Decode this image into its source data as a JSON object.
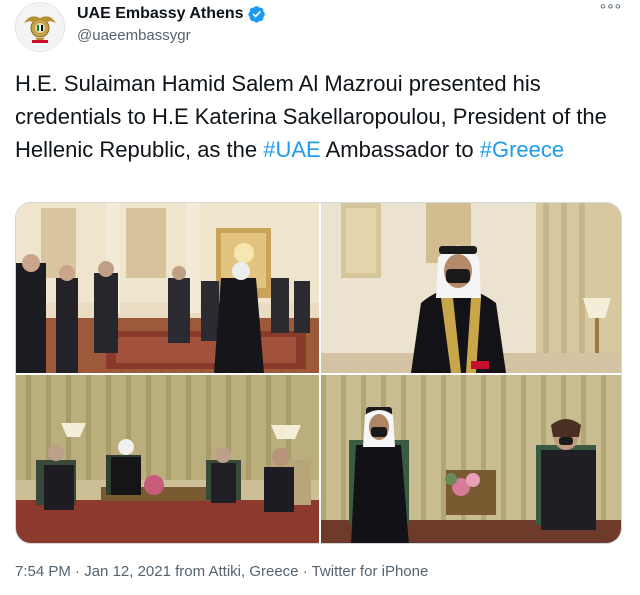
{
  "account": {
    "display_name": "UAE Embassy Athens",
    "handle": "@uaeembassygr",
    "verified": true,
    "avatar_icon": "uae-emblem-icon"
  },
  "more_label": "°°°",
  "tweet": {
    "text_before_uae": "H.E. Sulaiman Hamid Salem Al Mazroui presented his credentials to H.E Katerina Sakellaropoulou, President of the Hellenic Republic, as the ",
    "hashtag_uae": "#UAE",
    "text_after_uae": " Ambassador to ",
    "hashtag_greece": "#Greece"
  },
  "media": {
    "photos": [
      {
        "alt_icon": "ceremony-hall-photo"
      },
      {
        "alt_icon": "ambassador-portrait-photo"
      },
      {
        "alt_icon": "meeting-wide-photo"
      },
      {
        "alt_icon": "meeting-closeup-photo"
      }
    ]
  },
  "footer": {
    "time": "7:54 PM",
    "date": "Jan 12, 2021",
    "location": "from Attiki, Greece",
    "source": "Twitter for iPhone",
    "separator": "·"
  },
  "colors": {
    "link": "#1d9bf0",
    "secondary_text": "#536471",
    "verified_badge": "#1d9bf0"
  }
}
